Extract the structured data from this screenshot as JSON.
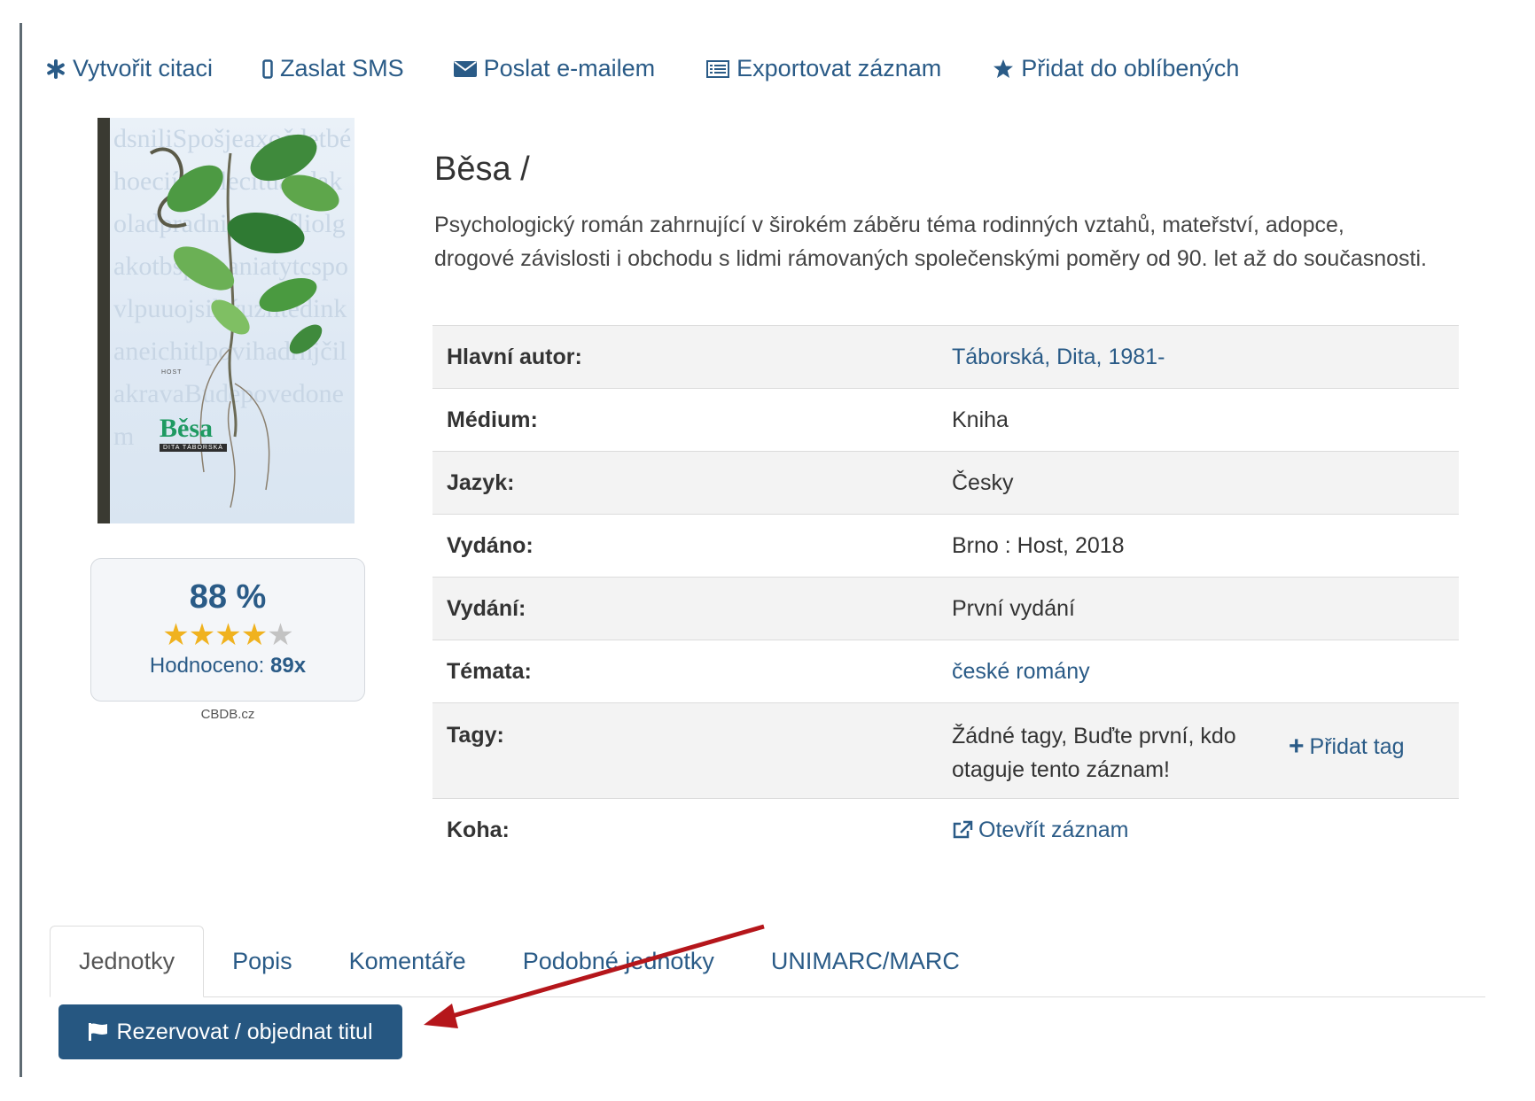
{
  "toolbar": {
    "cite_label": "Vytvořit citaci",
    "sms_label": "Zaslat SMS",
    "email_label": "Poslat e-mailem",
    "export_label": "Exportovat záznam",
    "favorite_label": "Přidat do oblíbených"
  },
  "cover": {
    "publisher": "HOST",
    "title": "Běsa",
    "author": "DITA TÁBORSKÁ"
  },
  "rating": {
    "percent": "88 %",
    "stars_filled": 4,
    "stars_total": 5,
    "count_label": "Hodnoceno:",
    "count_value": "89",
    "count_suffix": "x",
    "source": "CBDB.cz"
  },
  "record": {
    "title": "Běsa /",
    "description": "Psychologický román zahrnující v širokém záběru téma rodinných vztahů, mateřství, adopce, drogové závislosti i obchodu s lidmi rámovaných společenskými poměry od 90. let až do současnosti."
  },
  "details": {
    "author_label": "Hlavní autor:",
    "author_value": "Táborská, Dita, 1981-",
    "medium_label": "Médium:",
    "medium_value": "Kniha",
    "language_label": "Jazyk:",
    "language_value": "Česky",
    "published_label": "Vydáno:",
    "published_value": "Brno : Host, 2018",
    "edition_label": "Vydání:",
    "edition_value": "První vydání",
    "topics_label": "Témata:",
    "topics_value": "české romány",
    "tags_label": "Tagy:",
    "tags_value": "Žádné tagy, Buďte první, kdo otaguje tento záznam!",
    "add_tag_label": "Přidat tag",
    "koha_label": "Koha:",
    "koha_value": "Otevřít záznam"
  },
  "tabs": {
    "units": "Jednotky",
    "description": "Popis",
    "comments": "Komentáře",
    "similar": "Podobné jednotky",
    "marc": "UNIMARC/MARC"
  },
  "actions": {
    "reserve_label": "Rezervovat / objednat titul"
  },
  "colors": {
    "link": "#2a5b87",
    "button": "#265781",
    "star": "#f0b21f",
    "arrow": "#b5161b",
    "cover_title": "#1f9a62"
  }
}
